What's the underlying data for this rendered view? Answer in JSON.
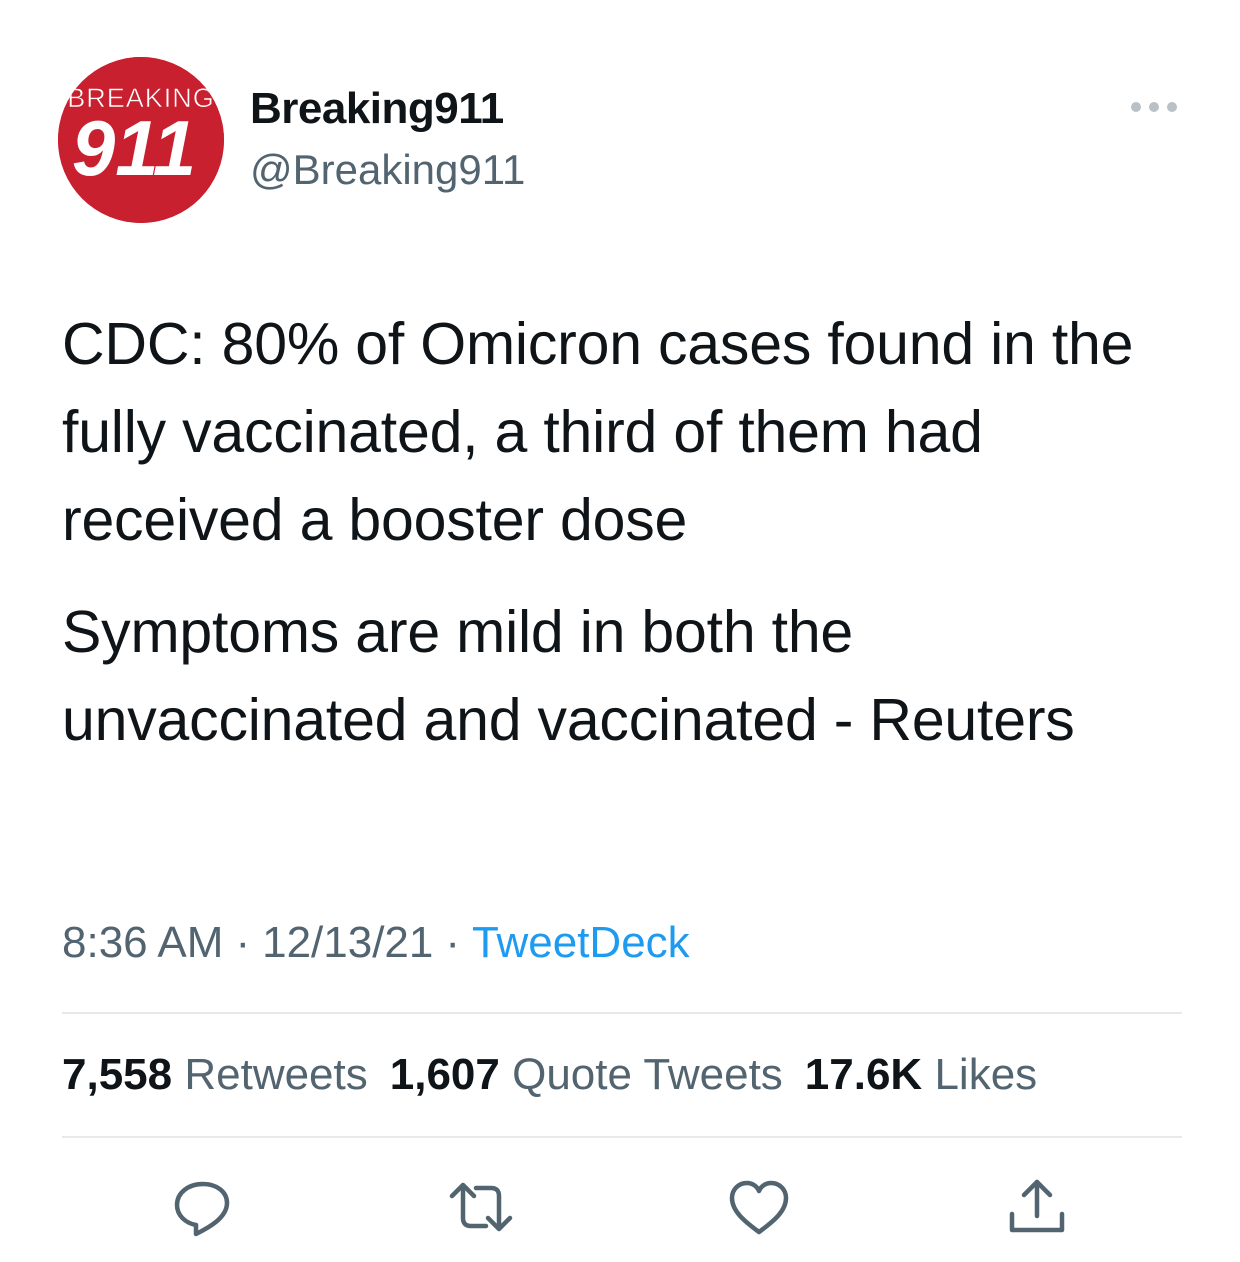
{
  "author": {
    "display_name": "Breaking911",
    "handle": "@Breaking911",
    "avatar": {
      "top_text": "BREAKING",
      "number": "911",
      "background_color": "#c8202f"
    }
  },
  "tweet": {
    "paragraph_1": "CDC: 80% of Omicron cases found in the fully vaccinated, a third of them had received a booster dose",
    "paragraph_2": "Symptoms are mild in both the unvaccinated and vaccinated - Reuters"
  },
  "meta": {
    "time": "8:36 AM",
    "separator": "·",
    "date": "12/13/21",
    "source": "TweetDeck"
  },
  "stats": {
    "retweets_count": "7,558",
    "retweets_label": "Retweets",
    "quotes_count": "1,607",
    "quotes_label": "Quote Tweets",
    "likes_count": "17.6K",
    "likes_label": "Likes"
  },
  "icons": {
    "more": "more-icon",
    "reply": "reply-icon",
    "retweet": "retweet-icon",
    "like": "heart-icon",
    "share": "share-icon"
  },
  "colors": {
    "text_primary": "#0f1419",
    "text_secondary": "#536471",
    "link": "#1d9bf0",
    "divider": "#e7e9ea"
  }
}
